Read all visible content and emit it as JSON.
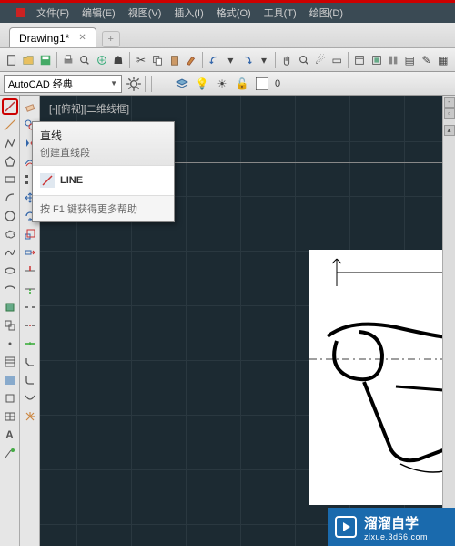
{
  "menubar": {
    "items": [
      "文件(F)",
      "编辑(E)",
      "视图(V)",
      "插入(I)",
      "格式(O)",
      "工具(T)",
      "绘图(D)"
    ]
  },
  "doctab": {
    "label": "Drawing1*"
  },
  "workspace": {
    "selected": "AutoCAD 经典"
  },
  "viewport_label": "[-][俯视][二维线框]",
  "tooltip": {
    "title": "直线",
    "desc": "创建直线段",
    "cmd_label": "LINE",
    "help": "按 F1 键获得更多帮助"
  },
  "watermark": {
    "brand": "溜溜自学",
    "url": "zixue.3d66.com"
  }
}
